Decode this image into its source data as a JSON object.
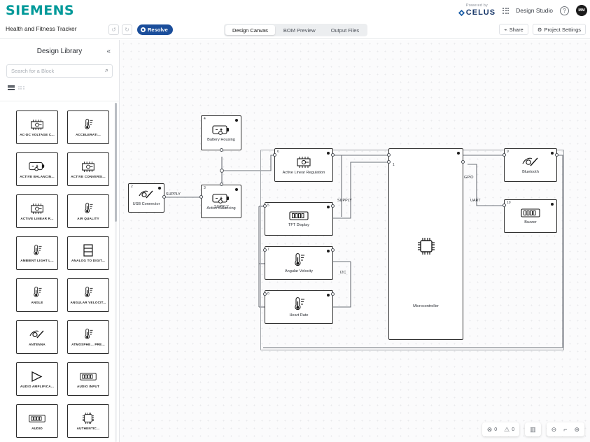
{
  "brand": {
    "siemens": "SIEMENS",
    "celus_powered": "Powered by",
    "celus_name": "CELUS",
    "app_switcher_label": "Design Studio",
    "help_glyph": "?",
    "avatar_initials": "MM"
  },
  "project": {
    "title": "Health and Fitness Tracker",
    "undo_glyph": "↺",
    "redo_glyph": "↻",
    "resolve_label": "Resolve"
  },
  "tabs": [
    {
      "label": "Design Canvas",
      "active": true
    },
    {
      "label": "BOM Preview",
      "active": false
    },
    {
      "label": "Output Files",
      "active": false
    }
  ],
  "actions": {
    "share_label": "Share",
    "share_glyph": "⌁",
    "settings_label": "Project Settings",
    "settings_glyph": "⚙"
  },
  "sidebar": {
    "title": "Design Library",
    "collapse_glyph": "«",
    "search_placeholder": "Search for a Block",
    "search_value": "",
    "search_glyph": "⌕",
    "blocks": [
      {
        "name": "AC-DC VOLTAGE C...",
        "icon": "ic-chip"
      },
      {
        "name": "ACCELERATI...",
        "icon": "ic-sensor"
      },
      {
        "name": "ACTIVE BALANCIN...",
        "icon": "ic-battery"
      },
      {
        "name": "ACTIVE CONVERSI...",
        "icon": "ic-chip"
      },
      {
        "name": "ACTIVE LINEAR R...",
        "icon": "ic-chip"
      },
      {
        "name": "AIR QUALITY",
        "icon": "ic-sensor"
      },
      {
        "name": "AMBIENT LIGHT L...",
        "icon": "ic-sensor"
      },
      {
        "name": "ANALOG TO DIGIT...",
        "icon": "ic-adc"
      },
      {
        "name": "ANGLE",
        "icon": "ic-sensor"
      },
      {
        "name": "ANGULAR VELOCIT...",
        "icon": "ic-sensor"
      },
      {
        "name": "ANTENNA",
        "icon": "ic-antenna"
      },
      {
        "name": "ATMOSPHE... PRE...",
        "icon": "ic-sensor"
      },
      {
        "name": "AUDIO AMPLIFICA...",
        "icon": "ic-amp"
      },
      {
        "name": "AUDIO INPUT",
        "icon": "ic-connector"
      },
      {
        "name": "AUDIO",
        "icon": "ic-connector"
      },
      {
        "name": "AUTHENTIC...",
        "icon": "ic-qfn"
      }
    ]
  },
  "canvas": {
    "nodes": [
      {
        "num": "2",
        "label": "USB Connector",
        "icon": "ic-antenna"
      },
      {
        "num": "3",
        "label": "Active Balancing",
        "icon": "ic-battery"
      },
      {
        "num": "4",
        "label": "Battery Housing",
        "icon": "ic-battery"
      },
      {
        "num": "6",
        "label": "Active Linear Regulation",
        "icon": "ic-chip"
      },
      {
        "num": "5",
        "label": "TFT Display",
        "icon": "ic-connector"
      },
      {
        "num": "7",
        "label": "Angular Velocity",
        "icon": "ic-sensor"
      },
      {
        "num": "8",
        "label": "Heart Rate",
        "icon": "ic-sensor"
      },
      {
        "num": "9",
        "label": "Bluetooth",
        "icon": "ic-antenna"
      },
      {
        "num": "10",
        "label": "Buzzer",
        "icon": "ic-connector"
      }
    ],
    "mcu": {
      "num": "1",
      "label": "Microcontroller",
      "icon": "ic-qfn"
    },
    "net_labels": [
      "SUPPLY",
      "SUPPLY",
      "SUPPLY",
      "UART",
      "GPIO",
      "I2C"
    ],
    "toolbar": {
      "error_glyph": "⊗",
      "error_count": "0",
      "warning_glyph": "⚠",
      "warning_count": "0",
      "legend_glyph": "▥",
      "zoom_out_glyph": "⊖",
      "fit_glyph": "⌐",
      "zoom_in_glyph": "⊕"
    }
  }
}
